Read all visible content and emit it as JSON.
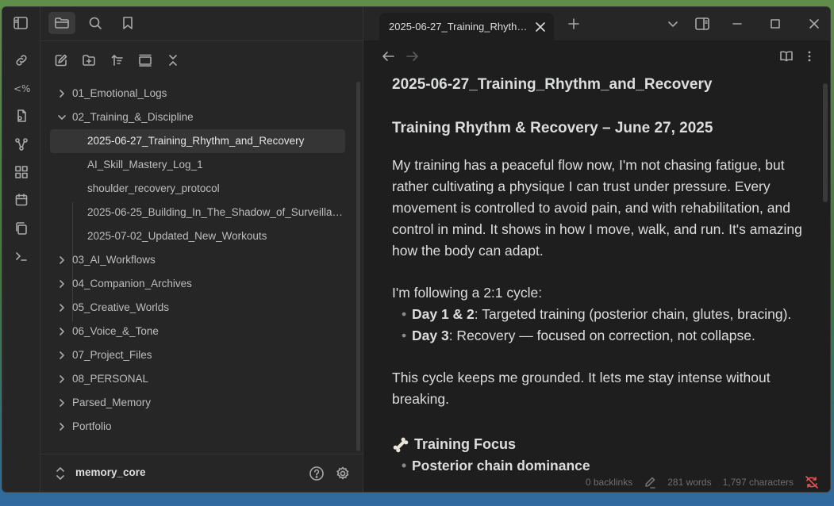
{
  "sidebar": {
    "tree": [
      {
        "type": "folder",
        "label": "01_Emotional_Logs",
        "expanded": false
      },
      {
        "type": "folder",
        "label": "02_Training_&_Discipline",
        "expanded": true
      },
      {
        "type": "file",
        "label": "2025-06-27_Training_Rhythm_and_Recovery",
        "selected": true
      },
      {
        "type": "file",
        "label": "AI_Skill_Mastery_Log_1"
      },
      {
        "type": "file",
        "label": "shoulder_recovery_protocol"
      },
      {
        "type": "file",
        "label": "2025-06-25_Building_In_The_Shadow_of_Surveillance"
      },
      {
        "type": "file",
        "label": "2025-07-02_Updated_New_Workouts"
      },
      {
        "type": "folder",
        "label": "03_AI_Workflows",
        "expanded": false
      },
      {
        "type": "folder",
        "label": "04_Companion_Archives",
        "expanded": false
      },
      {
        "type": "folder",
        "label": "05_Creative_Worlds",
        "expanded": false
      },
      {
        "type": "folder",
        "label": "06_Voice_&_Tone",
        "expanded": false
      },
      {
        "type": "folder",
        "label": "07_Project_Files",
        "expanded": false
      },
      {
        "type": "folder",
        "label": "08_PERSONAL",
        "expanded": false
      },
      {
        "type": "folder",
        "label": "Parsed_Memory",
        "expanded": false
      },
      {
        "type": "folder",
        "label": "Portfolio",
        "expanded": false
      }
    ],
    "vault_name": "memory_core"
  },
  "tab": {
    "title": "2025-06-27_Training_Rhythm_and_Recovery"
  },
  "note": {
    "inline_title": "2025-06-27_Training_Rhythm_and_Recovery",
    "heading": "Training Rhythm & Recovery – June 27, 2025",
    "para1": "My training has a peaceful flow now, I'm not chasing fatigue, but rather cultivating a physique I can trust under pressure. Every movement is controlled to avoid pain, and with rehabilitation, and control in mind. It shows in how I move, walk, and run. It's amazing how the body can adapt.",
    "para2": "I'm following a 2:1 cycle:",
    "list": [
      {
        "bold": "Day 1 & 2",
        "text": ": Targeted training (posterior chain, glutes, bracing)."
      },
      {
        "bold": "Day 3",
        "text": ": Recovery — focused on correction, not collapse."
      }
    ],
    "para3": "This cycle keeps me grounded. It lets me stay intense without breaking.",
    "section_heading": "Training Focus",
    "partial_item": "Posterior chain dominance"
  },
  "status": {
    "backlinks": "0 backlinks",
    "words": "281 words",
    "characters": "1,797 characters"
  },
  "icons": {
    "ribbon": [
      "link-icon",
      "code-icon",
      "page-icon",
      "graph-icon",
      "blocks-icon",
      "calendar-icon",
      "copy-icon",
      "terminal-icon"
    ],
    "sidebar_tabs": [
      "sidebar-toggle-icon",
      "folder-icon",
      "search-icon",
      "bookmark-icon"
    ]
  }
}
